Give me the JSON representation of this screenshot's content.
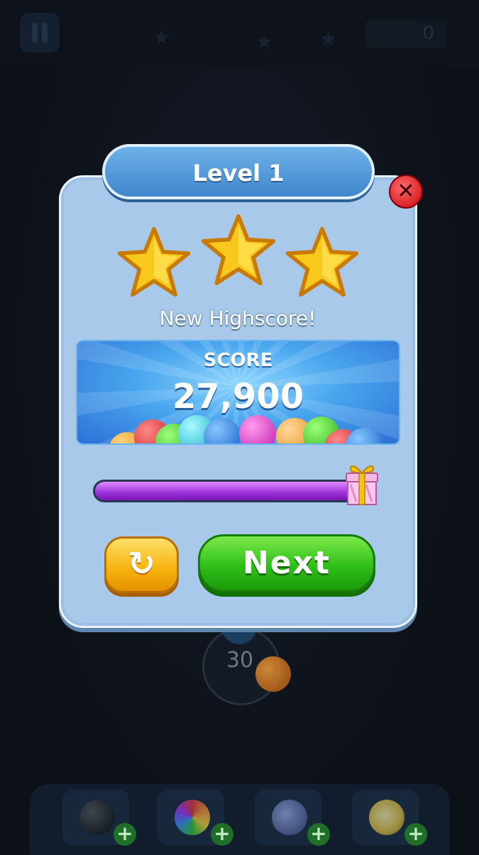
{
  "hud": {
    "coins": "0"
  },
  "shooter": {
    "shots_left": "30"
  },
  "popup": {
    "level_title": "Level 1",
    "stars_earned": 3,
    "stars_total": 3,
    "highscore_text": "New Highscore!",
    "score_label": "SCORE",
    "score_value": "27,900",
    "progress": 1.0,
    "replay_icon": "replay-icon",
    "next_label": "Next",
    "close_icon": "close-icon"
  },
  "boosters": [
    {
      "name": "bomb",
      "icon": "bomb-icon"
    },
    {
      "name": "rainbow-ball",
      "icon": "rainbow-ball-icon"
    },
    {
      "name": "lightning-ball",
      "icon": "lightning-ball-icon"
    },
    {
      "name": "fire-ball",
      "icon": "fire-ball-icon"
    }
  ],
  "colors": {
    "panel": "#a8c9e9",
    "header": "#4f97d8",
    "next_button": "#2fbf19",
    "replay_button": "#f6b10c",
    "progress_fill": "#9a2ed6",
    "star": "#f8c81c"
  }
}
